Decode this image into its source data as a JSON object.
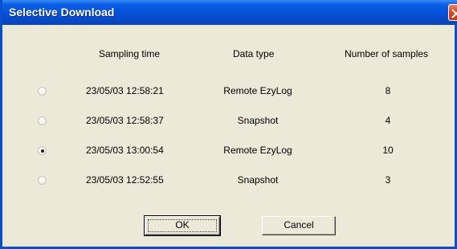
{
  "window": {
    "title": "Selective Download"
  },
  "headers": {
    "sampling_time": "Sampling time",
    "data_type": "Data type",
    "number_of_samples": "Number of samples"
  },
  "rows": [
    {
      "time": "23/05/03 12:58:21",
      "type": "Remote EzyLog",
      "count": "8",
      "selected": false
    },
    {
      "time": "23/05/03 12:58:37",
      "type": "Snapshot",
      "count": "4",
      "selected": false
    },
    {
      "time": "23/05/03 13:00:54",
      "type": "Remote EzyLog",
      "count": "10",
      "selected": true
    },
    {
      "time": "23/05/03 12:52:55",
      "type": "Snapshot",
      "count": "3",
      "selected": false
    }
  ],
  "buttons": {
    "ok": "OK",
    "cancel": "Cancel"
  },
  "icons": {
    "close": "close-icon"
  },
  "colors": {
    "titlebar": "#0650d8",
    "close_button": "#d8471f",
    "dialog_bg": "#ece9d8"
  }
}
